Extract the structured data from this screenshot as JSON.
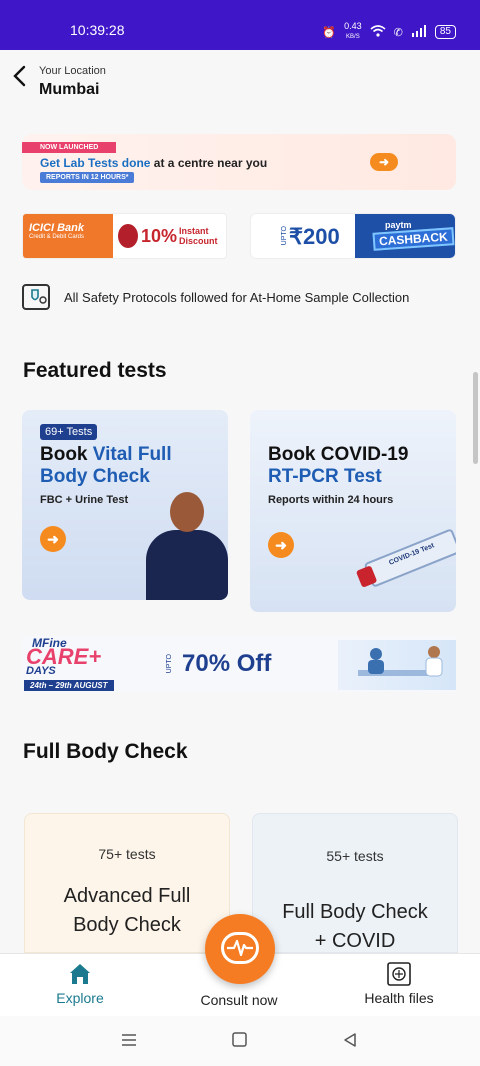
{
  "status_bar": {
    "time": "10:39:28",
    "speed": "0.43",
    "speed_unit": "KB/S",
    "battery": "85"
  },
  "header": {
    "location_label": "Your Location",
    "city": "Mumbai"
  },
  "lab_banner": {
    "tag": "NOW LAUNCHED",
    "title_blue": "Get Lab Tests done",
    "title_dark": " at a centre near you",
    "reports": "REPORTS IN 12 HOURS*",
    "arrow": "➜"
  },
  "icici_banner": {
    "bank": "ICICI Bank",
    "cards": "Credit & Debit Cards",
    "percent": "10%",
    "discount": "Instant Discount"
  },
  "paytm_banner": {
    "upto": "UPTO",
    "amount": "₹200",
    "brand": "paytm",
    "cashback": "CASHBACK"
  },
  "safety": {
    "text": "All Safety Protocols followed for At-Home Sample Collection"
  },
  "featured": {
    "heading": "Featured tests",
    "cards": [
      {
        "badge": "69+ Tests",
        "title_line1": "Book ",
        "title_line1_blue": "Vital Full",
        "title_line2_blue": "Body Check",
        "subtitle": "FBC + Urine Test",
        "arrow": "➜"
      },
      {
        "title_line1": "Book COVID-19",
        "title_line2_blue": "RT-PCR Test",
        "subtitle": "Reports within 24 hours",
        "tube_label": "COVID-19 Test",
        "arrow": "➜"
      }
    ]
  },
  "care_banner": {
    "brand": "MFine",
    "care": "CARE+",
    "days": "DAYS",
    "dates": "24th – 29th AUGUST",
    "upto": "UPTO",
    "offer": "70% Off"
  },
  "full_body": {
    "heading": "Full Body Check",
    "cards": [
      {
        "count": "75+ tests",
        "title": "Advanced Full Body Check"
      },
      {
        "count": "55+ tests",
        "title": "Full Body Check + COVID"
      }
    ]
  },
  "bottom_nav": {
    "explore": "Explore",
    "consult": "Consult now",
    "health": "Health files"
  },
  "colors": {
    "status_bar": "#3f16c8",
    "accent_orange": "#f57c22",
    "explore_active": "#1b7a8f"
  }
}
